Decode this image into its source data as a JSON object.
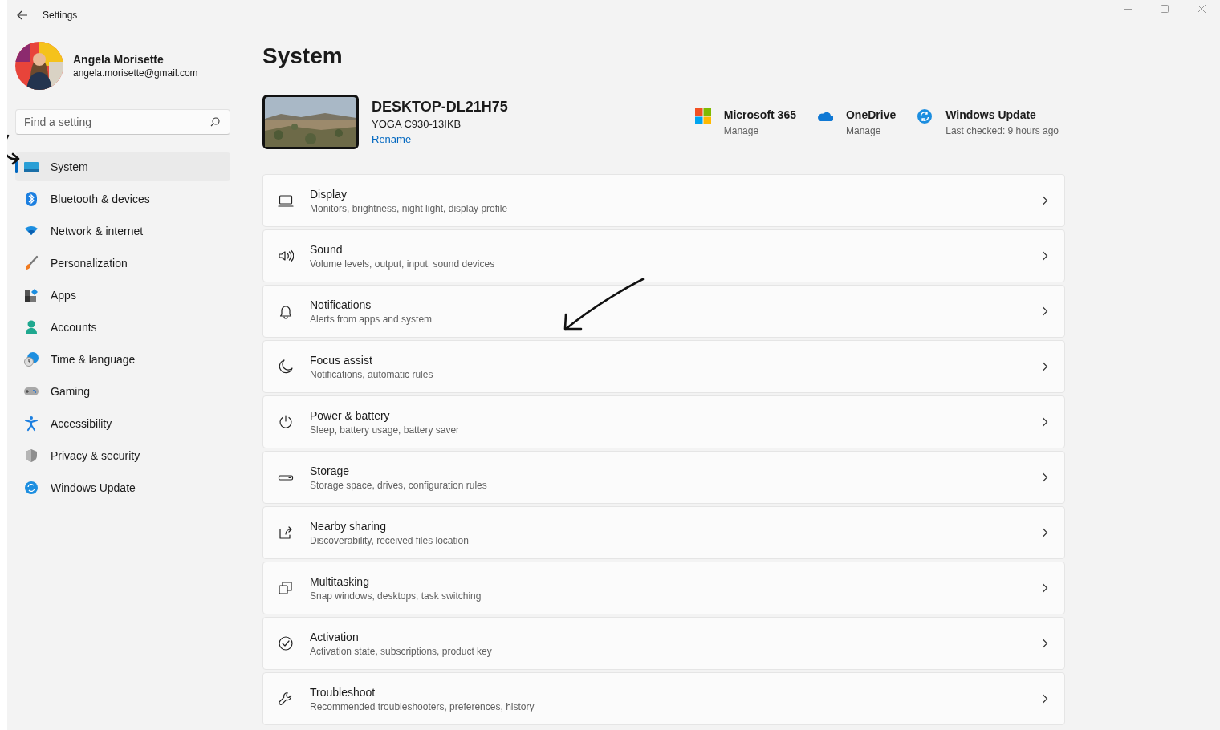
{
  "window": {
    "title": "Settings"
  },
  "profile": {
    "name": "Angela Morisette",
    "email": "angela.morisette@gmail.com"
  },
  "search": {
    "placeholder": "Find a setting"
  },
  "sidebar": {
    "items": [
      {
        "label": "System",
        "selected": true
      },
      {
        "label": "Bluetooth & devices",
        "selected": false
      },
      {
        "label": "Network & internet",
        "selected": false
      },
      {
        "label": "Personalization",
        "selected": false
      },
      {
        "label": "Apps",
        "selected": false
      },
      {
        "label": "Accounts",
        "selected": false
      },
      {
        "label": "Time & language",
        "selected": false
      },
      {
        "label": "Gaming",
        "selected": false
      },
      {
        "label": "Accessibility",
        "selected": false
      },
      {
        "label": "Privacy & security",
        "selected": false
      },
      {
        "label": "Windows Update",
        "selected": false
      }
    ]
  },
  "page_title": "System",
  "device": {
    "name": "DESKTOP-DL21H75",
    "model": "YOGA C930-13IKB",
    "rename_link": "Rename"
  },
  "quick_links": [
    {
      "title": "Microsoft 365",
      "subtitle": "Manage"
    },
    {
      "title": "OneDrive",
      "subtitle": "Manage"
    },
    {
      "title": "Windows Update",
      "subtitle": "Last checked: 9 hours ago"
    }
  ],
  "settings": [
    {
      "title": "Display",
      "description": "Monitors, brightness, night light, display profile"
    },
    {
      "title": "Sound",
      "description": "Volume levels, output, input, sound devices"
    },
    {
      "title": "Notifications",
      "description": "Alerts from apps and system"
    },
    {
      "title": "Focus assist",
      "description": "Notifications, automatic rules"
    },
    {
      "title": "Power & battery",
      "description": "Sleep, battery usage, battery saver"
    },
    {
      "title": "Storage",
      "description": "Storage space, drives, configuration rules"
    },
    {
      "title": "Nearby sharing",
      "description": "Discoverability, received files location"
    },
    {
      "title": "Multitasking",
      "description": "Snap windows, desktops, task switching"
    },
    {
      "title": "Activation",
      "description": "Activation state, subscriptions, product key"
    },
    {
      "title": "Troubleshoot",
      "description": "Recommended troubleshooters, preferences, history"
    }
  ]
}
